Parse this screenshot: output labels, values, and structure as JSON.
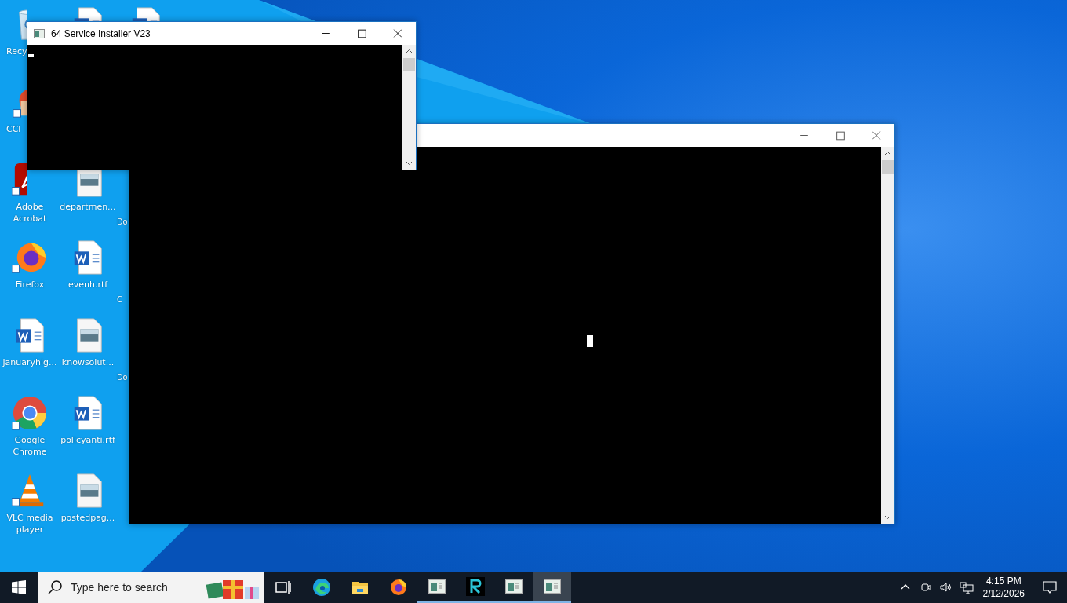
{
  "desktop": {
    "columns": [
      [
        {
          "kind": "recycle",
          "label": "Recy"
        },
        {
          "kind": "ccleaner",
          "label": "CCl"
        },
        {
          "kind": "acrobat",
          "label": "Adobe Acrobat"
        },
        {
          "kind": "firefox",
          "label": "Firefox"
        },
        {
          "kind": "word",
          "label": "januaryhig..."
        },
        {
          "kind": "chrome",
          "label": "Google Chrome"
        },
        {
          "kind": "vlc",
          "label": "VLC media player"
        }
      ],
      [
        {
          "kind": "word"
        },
        {
          "kind": "empty"
        },
        {
          "kind": "image",
          "label": "departmen..."
        },
        {
          "kind": "word",
          "label": "evenh.rtf"
        },
        {
          "kind": "image",
          "label": "knowsolut..."
        },
        {
          "kind": "word",
          "label": "policyanti.rtf"
        },
        {
          "kind": "image",
          "label": "postedpag..."
        }
      ],
      [
        {
          "kind": "word"
        },
        {
          "kind": "empty"
        },
        {
          "kind": "cut",
          "label": "Do"
        },
        {
          "kind": "cut",
          "label": "C"
        },
        {
          "kind": "cut",
          "label": "Do"
        }
      ]
    ]
  },
  "back_window": {
    "cursor": true
  },
  "front_window": {
    "title": "64 Service Installer V23",
    "cursor": true
  },
  "taskbar": {
    "search": {
      "placeholder": "Type here to search"
    },
    "apps": [
      {
        "kind": "task-view",
        "running": false,
        "selected": false
      },
      {
        "kind": "edge",
        "running": false,
        "selected": false
      },
      {
        "kind": "explorer",
        "running": false,
        "selected": false
      },
      {
        "kind": "firefox",
        "running": false,
        "selected": false
      },
      {
        "kind": "console",
        "running": true,
        "selected": false
      },
      {
        "kind": "r-app",
        "running": true,
        "selected": false
      },
      {
        "kind": "console",
        "running": true,
        "selected": false
      },
      {
        "kind": "console",
        "running": true,
        "selected": true
      }
    ],
    "time": "4:15 PM",
    "date": "2/12/2026"
  }
}
